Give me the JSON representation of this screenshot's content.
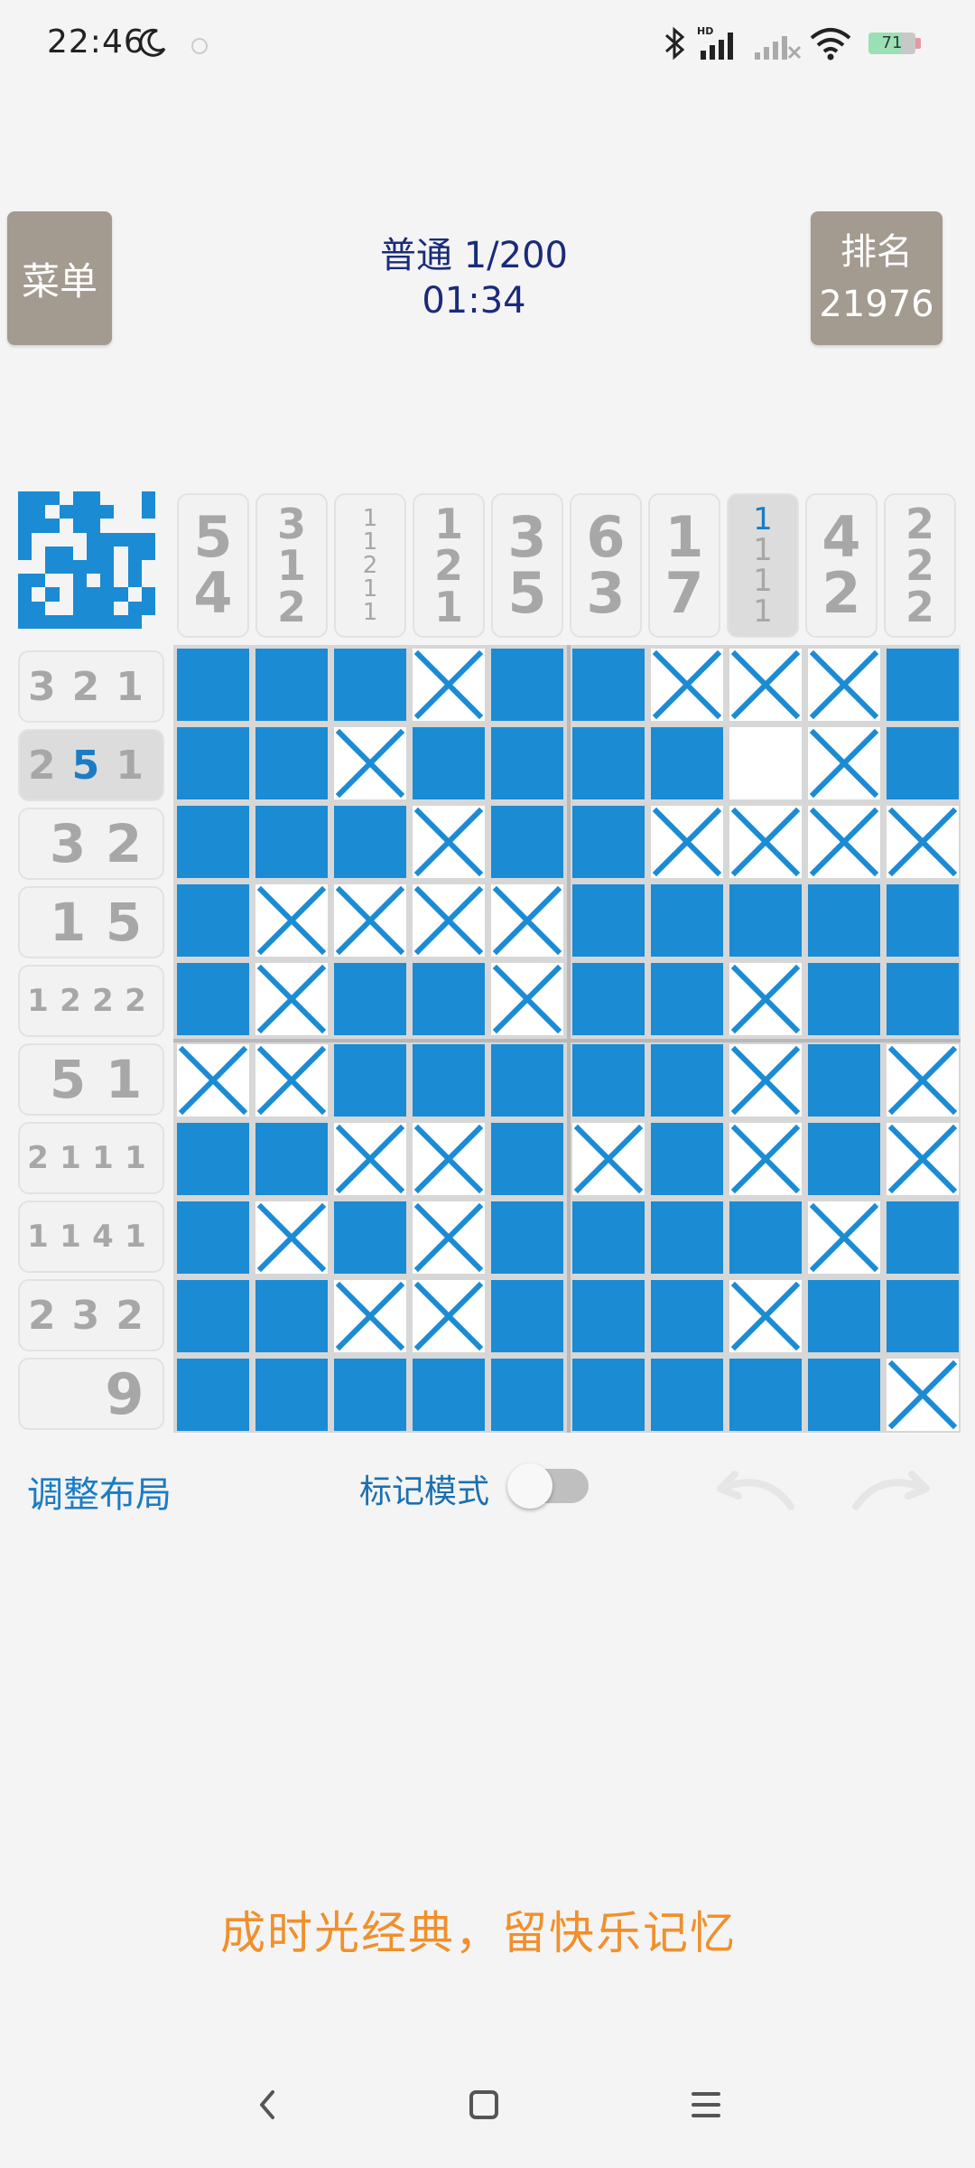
{
  "status_bar": {
    "time": "22:46",
    "battery_level": "71",
    "icons": [
      "moon-icon",
      "bluetooth-icon",
      "signal-hd-icon",
      "signal-icon",
      "wifi-icon",
      "battery-icon"
    ]
  },
  "header": {
    "menu_label": "菜单",
    "level_title": "普通 1/200",
    "timer": "01:34",
    "rank_label": "排名",
    "rank_value": "21976",
    "colors": {
      "button_bg": "#a39a90",
      "title": "#1a2b7a"
    }
  },
  "puzzle": {
    "size": 10,
    "fill_color": "#1b8bd4",
    "column_clues": [
      [
        "5",
        "4"
      ],
      [
        "3",
        "1",
        "2"
      ],
      [
        "1",
        "1",
        "2",
        "1",
        "1"
      ],
      [
        "1",
        "2",
        "1"
      ],
      [
        "3",
        "5"
      ],
      [
        "6",
        "3"
      ],
      [
        "1",
        "7"
      ],
      [
        "1",
        "1",
        "1",
        "1"
      ],
      [
        "4",
        "2"
      ],
      [
        "2",
        "2",
        "2"
      ]
    ],
    "active_column": 7,
    "row_clues": [
      [
        "3",
        "2",
        "1"
      ],
      [
        "2",
        "5",
        "1"
      ],
      [
        "3",
        "2"
      ],
      [
        "1",
        "5"
      ],
      [
        "1",
        "2",
        "2",
        "2"
      ],
      [
        "5",
        "1"
      ],
      [
        "2",
        "1",
        "1",
        "1"
      ],
      [
        "1",
        "1",
        "4",
        "1"
      ],
      [
        "2",
        "3",
        "2"
      ],
      [
        "9"
      ]
    ],
    "active_row": 1,
    "grid": [
      "FFFXFFXXXF",
      "FFXFFFFEXF",
      "FFFXFFXXXX",
      "FXXXXFFFFF",
      "FXFFXFFXFF",
      "XXFFFFFXFX",
      "FFXXFXFXFX",
      "FXFXFFFFXF",
      "FFXXFFFXFF",
      "FFFFFFFFFX"
    ],
    "preview": [
      "1110110001",
      "1101111001",
      "1110110000",
      "1000011111",
      "1011011011",
      "0011111010",
      "1100101010",
      "1010111101",
      "1100111011",
      "1111111110"
    ]
  },
  "controls": {
    "adjust_layout": "调整布局",
    "mark_mode": "标记模式",
    "mark_mode_on": false
  },
  "slogan": "成时光经典，留快乐记忆",
  "nav_bar": [
    "back-icon",
    "home-icon",
    "menu-icon"
  ]
}
